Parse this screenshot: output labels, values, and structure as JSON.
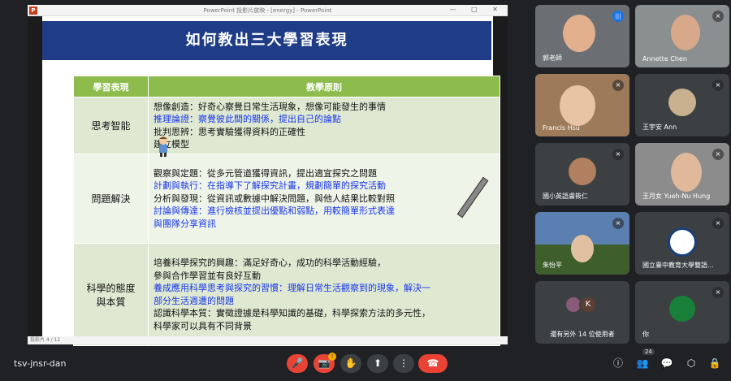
{
  "ppt": {
    "window_title": "PowerPoint 投影片放映 - [energy] - PowerPoint",
    "slide_title": "如何教出三大學習表現",
    "status": "投影片 4 / 12",
    "table": {
      "headers": [
        "學習表現",
        "教學原則"
      ],
      "rows": [
        {
          "label": "思考智能",
          "lines": [
            {
              "text": "想像創造：好奇心察覺日常生活現象，想像可能發生的事情",
              "color": "black"
            },
            {
              "text": "推理論證：察覺彼此間的關係，提出自己的論點",
              "color": "blue"
            },
            {
              "text": "批判思辨：思考實驗獲得資料的正確性",
              "color": "black"
            },
            {
              "text": "建立模型",
              "color": "black"
            }
          ]
        },
        {
          "label": "問題解決",
          "lines": [
            {
              "text": "觀察與定題：從多元管道獲得資訊，提出適宜探究之問題",
              "color": "black"
            },
            {
              "text": "計劃與執行：在指導下了解探究計畫，規劃簡單的探究活動",
              "color": "blue"
            },
            {
              "text": "分析與發現：從資訊或數據中解決問題，與他人結果比較對照",
              "color": "black"
            },
            {
              "text": "討論與傳達：進行檢核並提出優點和弱點，用較簡單形式表達",
              "color": "blue"
            },
            {
              "text": "與團隊分享資訊",
              "color": "blue"
            }
          ]
        },
        {
          "label": "科學的態度與本質",
          "lines": [
            {
              "text": "培養科學探究的興趣：滿足好奇心，成功的科學活動經驗，",
              "color": "black"
            },
            {
              "text": "參與合作學習並有良好互動",
              "color": "black"
            },
            {
              "text": "養成應用科學思考與探究的習慣：理解日常生活觀察到的現象，解決一",
              "color": "blue"
            },
            {
              "text": "部分生活週遭的問題",
              "color": "blue"
            },
            {
              "text": "認識科學本質：實徵證據是科學知識的基礎，科學探索方法的多元性，",
              "color": "black"
            },
            {
              "text": "科學家可以具有不同背景",
              "color": "black"
            }
          ]
        }
      ]
    }
  },
  "participants": [
    {
      "name": "郭老師",
      "status": "speaking",
      "bg": "#6b6f73",
      "face": "#e3b08e"
    },
    {
      "name": "Annette Chen",
      "status": "muted",
      "bg": "#8a8f90",
      "face": "#d7a98a"
    },
    {
      "name": "Francis Hsu",
      "status": "muted",
      "bg": "#9c7a5a",
      "face": "#e8c3a4"
    },
    {
      "name": "王宇安 Ann",
      "status": "muted",
      "bg": "#3c4043",
      "face": "#c9b08e"
    },
    {
      "name": "國小英語盧筱仁",
      "status": "muted",
      "bg": "#3c4043",
      "face": "#b08060"
    },
    {
      "name": "王月女 Yueh-Nu Hung",
      "status": "muted",
      "bg": "#8c8c8c",
      "face": "#e0b89a"
    },
    {
      "name": "朱怡平",
      "status": "muted",
      "bg": "#3e5e2c",
      "face": "#e0c0a0"
    },
    {
      "name": "國立臺中教育大學雙語...",
      "status": "muted",
      "bg": "#3c4043",
      "face": "#ffffff"
    },
    {
      "name": "還有另外 14 位使用者",
      "status": "",
      "bg": "#3c4043",
      "face": "",
      "initial": "K"
    },
    {
      "name": "你",
      "status": "muted",
      "bg": "#3c4043",
      "face": "#188038"
    }
  ],
  "meeting": {
    "code": "tsv-jnsr-dan",
    "participant_count": "24",
    "alert_count": "!"
  },
  "controls": {
    "mic_icon": "🎤",
    "cam_icon": "📷",
    "hand_icon": "✋",
    "present_icon": "⬆",
    "more_icon": "⋮",
    "end_icon": "☎",
    "info_icon": "ⓘ",
    "people_icon": "👥",
    "chat_icon": "💬",
    "activities_icon": "⬡",
    "lock_icon": "🔒",
    "mute_glyph": "⨯",
    "speak_glyph": "|||"
  }
}
